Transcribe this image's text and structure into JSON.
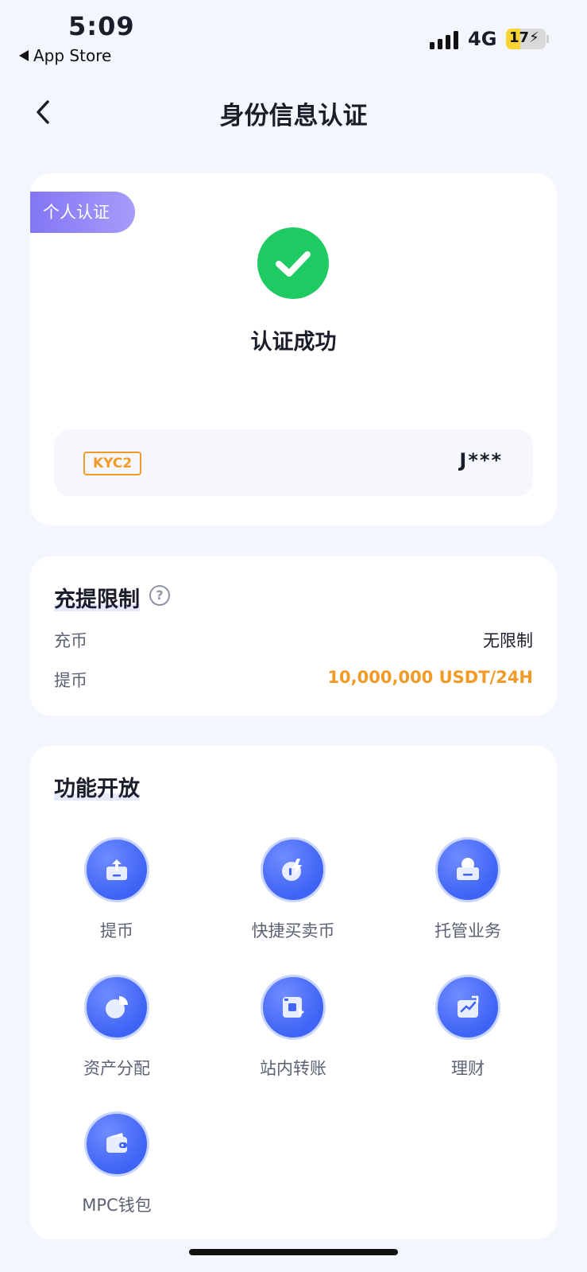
{
  "status_bar": {
    "time": "5:09",
    "back_app": "App Store",
    "network": "4G",
    "battery": "17"
  },
  "nav": {
    "title": "身份信息认证"
  },
  "verification": {
    "badge": "个人认证",
    "status": "认证成功",
    "kyc_level": "KYC2",
    "user_name": "J***",
    "status_color": "#1ecb63"
  },
  "limits": {
    "title": "充提限制",
    "help": "?",
    "rows": [
      {
        "label": "充币",
        "value": "无限制"
      },
      {
        "label": "提币",
        "value": "10,000,000 USDT/24H"
      }
    ],
    "accent_color": "#f29a26"
  },
  "features": {
    "title": "功能开放",
    "items": [
      {
        "label": "提币",
        "icon": "withdraw-icon"
      },
      {
        "label": "快捷买卖币",
        "icon": "quick-trade-icon"
      },
      {
        "label": "托管业务",
        "icon": "custody-icon"
      },
      {
        "label": "资产分配",
        "icon": "asset-allocation-icon"
      },
      {
        "label": "站内转账",
        "icon": "internal-transfer-icon"
      },
      {
        "label": "理财",
        "icon": "wealth-management-icon"
      },
      {
        "label": "MPC钱包",
        "icon": "wallet-icon"
      }
    ],
    "icon_color": "#3e63f5"
  }
}
